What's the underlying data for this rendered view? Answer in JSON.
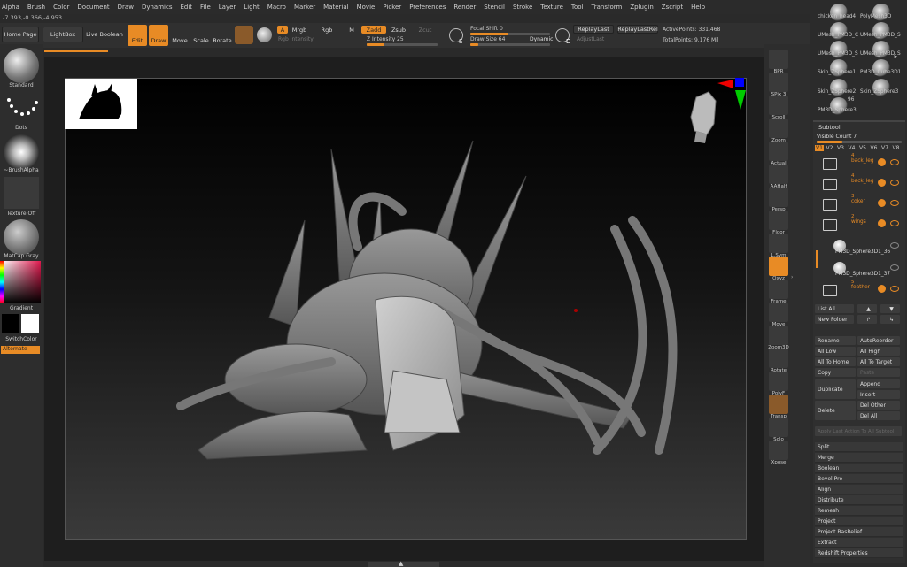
{
  "menu": [
    "Alpha",
    "Brush",
    "Color",
    "Document",
    "Draw",
    "Dynamics",
    "Edit",
    "File",
    "Layer",
    "Light",
    "Macro",
    "Marker",
    "Material",
    "Movie",
    "Picker",
    "Preferences",
    "Render",
    "Stencil",
    "Stroke",
    "Texture",
    "Tool",
    "Transform",
    "Zplugin",
    "Zscript",
    "Help"
  ],
  "coords": "-7.393,-0.366,-4.953",
  "toolbar": {
    "home_page": "Home Page",
    "lightbox": "LightBox",
    "live_boolean": "Live Boolean",
    "edit": "Edit",
    "draw": "Draw",
    "move": "Move",
    "scale": "Scale",
    "rotate": "Rotate",
    "a_label": "A",
    "mrgb": "Mrgb",
    "rgb": "Rgb",
    "m": "M",
    "zadd": "Zadd",
    "zsub": "Zsub",
    "zcut": "Zcut",
    "rgb_intensity": "Rgb Intensity",
    "z_intensity": "Z Intensity 25",
    "focal_shift": "Focal Shift 0",
    "draw_size": "Draw Size 64",
    "dynamic": "Dynamic",
    "replay_last": "ReplayLast",
    "replay_last_rel": "ReplayLastRel",
    "adjust_last": "AdjustLast",
    "active_points": "ActivePoints: 331,468",
    "total_points": "TotalPoints: 9.176 Mil",
    "s_letter": "S",
    "d_letter": "D"
  },
  "left": {
    "standard": "Standard",
    "dots": "Dots",
    "brush_alpha": "~BrushAlpha",
    "texture_off": "Texture Off",
    "matcap_gray": "MatCap Gray",
    "gradient": "Gradient",
    "switch_color": "SwitchColor",
    "alternate": "Alternate"
  },
  "right_tools": [
    {
      "name": "bpr-button",
      "label": "BPR"
    },
    {
      "name": "spix-button",
      "label": "SPix 3"
    },
    {
      "name": "scroll-button",
      "label": "Scroll"
    },
    {
      "name": "zoom-button",
      "label": "Zoom"
    },
    {
      "name": "actual-button",
      "label": "Actual"
    },
    {
      "name": "aahalf-button",
      "label": "AAHalf"
    },
    {
      "name": "persp-button",
      "label": "Persp"
    },
    {
      "name": "floor-button",
      "label": "Floor"
    },
    {
      "name": "lsym-button",
      "label": "L.Sym"
    },
    {
      "name": "xyz-button",
      "label": "Qxyz"
    },
    {
      "name": "frame-button",
      "label": "Frame"
    },
    {
      "name": "move-view-button",
      "label": "Move"
    },
    {
      "name": "zoom3d-button",
      "label": "Zoom3D"
    },
    {
      "name": "rotate-view-button",
      "label": "Rotate"
    },
    {
      "name": "polyf-button",
      "label": "PolyF"
    },
    {
      "name": "transp-button",
      "label": "Transp"
    },
    {
      "name": "solo-button",
      "label": "Solo"
    },
    {
      "name": "xpose-button",
      "label": "Xpose"
    }
  ],
  "tool_palette": [
    {
      "label": "chicken_head4"
    },
    {
      "label": "PolyMesh3D"
    },
    {
      "label": "UMesh_PM3D_C"
    },
    {
      "label": "UMesh_PM3D_S"
    },
    {
      "label": "UMesh_PM3D_S"
    },
    {
      "label": "UMesh_PM3D_S"
    },
    {
      "label": "Skin_ZSphere1"
    },
    {
      "label": "PM3D_Cube3D1"
    },
    {
      "label": "Skin_ZSphere2"
    },
    {
      "label": "Skin_ZSphere3"
    },
    {
      "label": "PM3D_Sphere3"
    }
  ],
  "tool_count_5": "5",
  "tool_count_96": "96",
  "subtool": {
    "title": "Subtool",
    "visible_count": "Visible Count 7",
    "versions": [
      "V1",
      "V2",
      "V3",
      "V4",
      "V5",
      "V6",
      "V7",
      "V8"
    ],
    "items": [
      {
        "num": "4",
        "label": "back_leg"
      },
      {
        "num": "4",
        "label": "back_leg"
      },
      {
        "num": "3",
        "label": "coker"
      },
      {
        "num": "2",
        "label": "wings"
      },
      {
        "num": "",
        "label": "PM3D_Sphere3D1_36"
      },
      {
        "num": "",
        "label": "PM3D_Sphere3D1_37"
      },
      {
        "num": "5",
        "label": "feather"
      }
    ]
  },
  "subtool_buttons": {
    "list_all": "List All",
    "new_folder": "New Folder",
    "rename": "Rename",
    "auto_reorder": "AutoReorder",
    "all_low": "All Low",
    "all_high": "All High",
    "all_to_home": "All To Home",
    "all_to_target": "All To Target",
    "copy": "Copy",
    "paste": "Paste",
    "duplicate": "Duplicate",
    "append": "Append",
    "insert": "Insert",
    "delete": "Delete",
    "del_other": "Del Other",
    "del_all": "Del All",
    "apply_last": "Apply Last Action To All Subtool"
  },
  "subtool_list": [
    "Split",
    "Merge",
    "Boolean",
    "Bevel Pro",
    "Align",
    "Distribute",
    "Remesh",
    "Project",
    "Project BasRelief",
    "Extract",
    "Redshift Properties"
  ],
  "colors": {
    "accent": "#e88b25",
    "bg": "#2b2b2b"
  }
}
